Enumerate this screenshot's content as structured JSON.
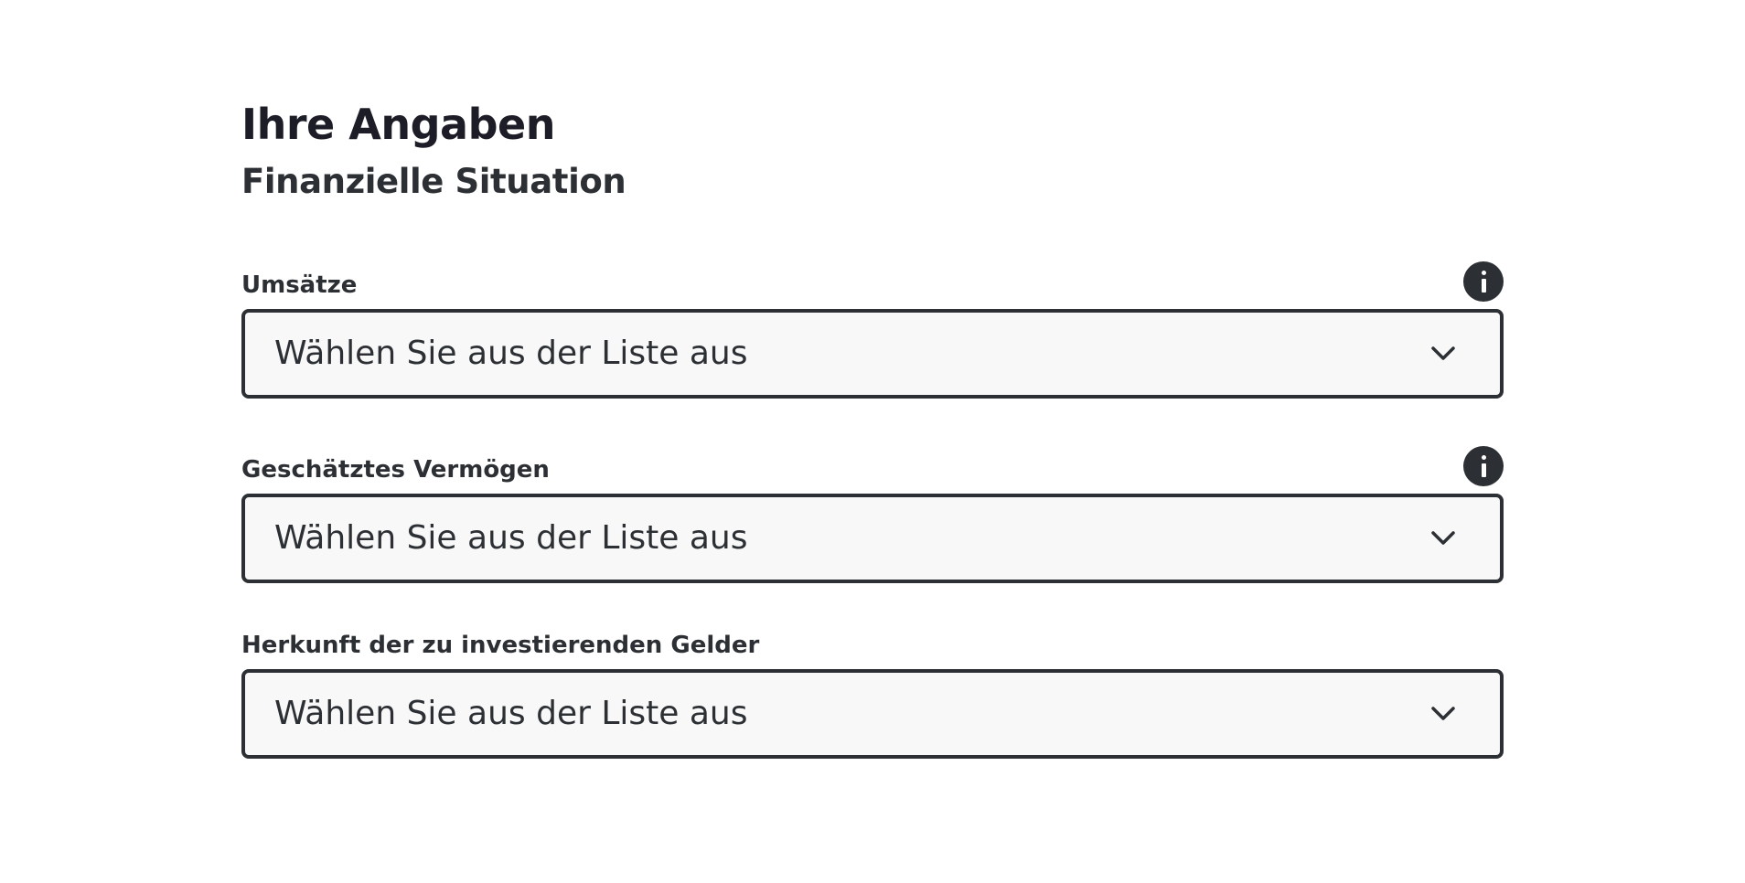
{
  "header": {
    "title": "Ihre Angaben",
    "subtitle": "Finanzielle Situation"
  },
  "fields": [
    {
      "label": "Umsätze",
      "value": "Wählen Sie aus der Liste aus",
      "has_info": true
    },
    {
      "label": "Geschätztes Vermögen",
      "value": "Wählen Sie aus der Liste aus",
      "has_info": true
    },
    {
      "label": "Herkunft der zu investierenden Gelder",
      "value": "Wählen Sie aus der Liste aus",
      "has_info": false
    }
  ],
  "icons": {
    "info": "info-icon",
    "chevron": "chevron-down-icon"
  },
  "colors": {
    "text_primary": "#1c1d26",
    "text_secondary": "#2c2f33",
    "select_background": "#f8f8f8",
    "select_border": "#2c2f33"
  }
}
